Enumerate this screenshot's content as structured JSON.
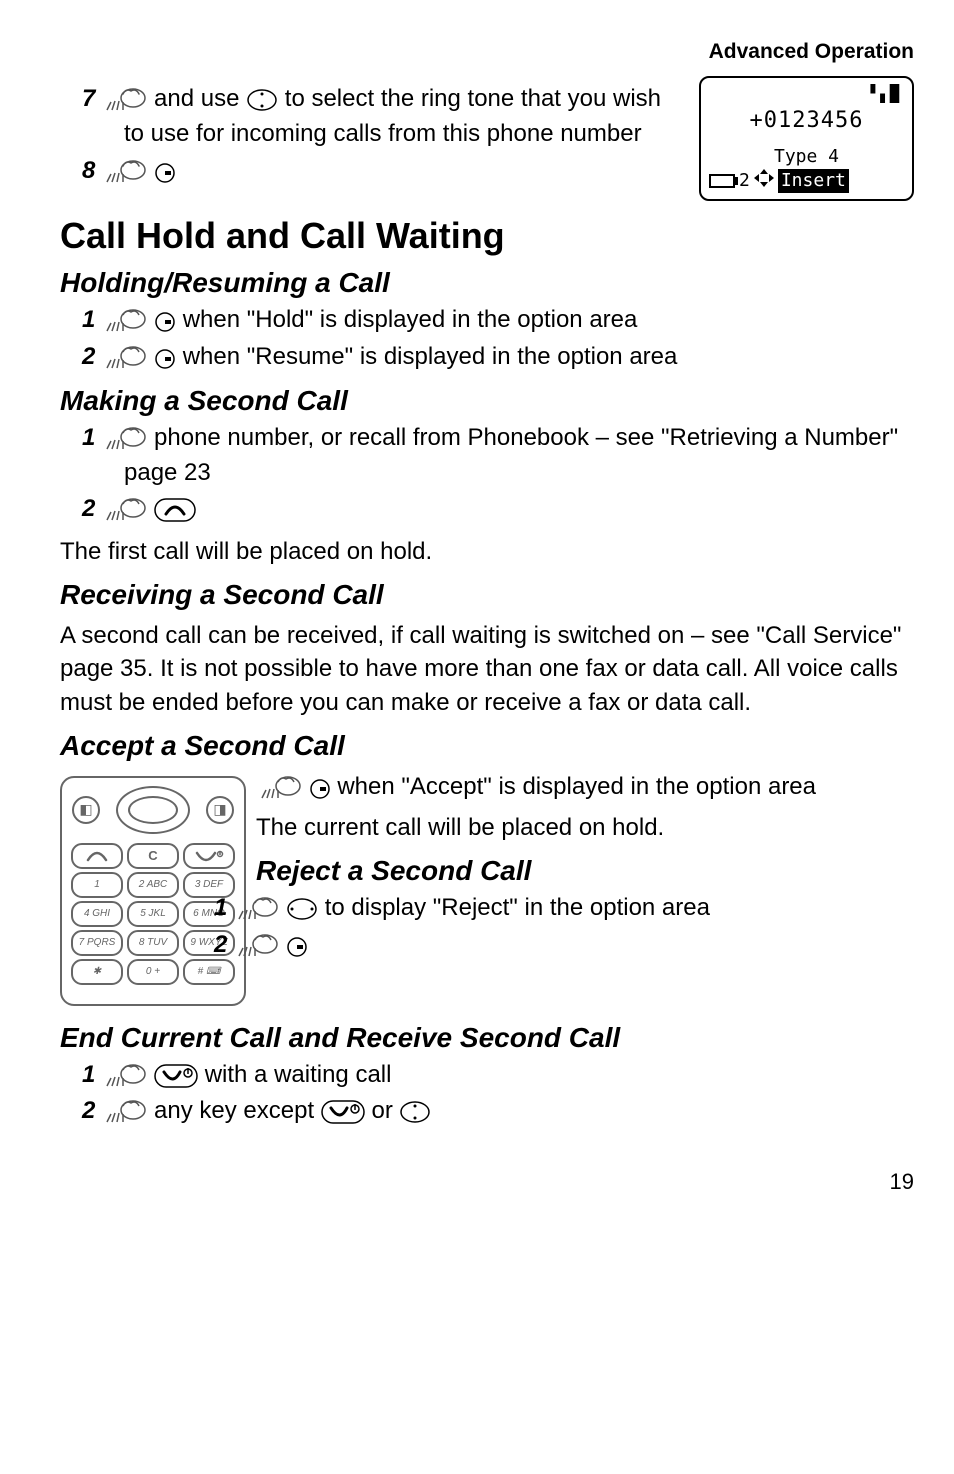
{
  "header": {
    "section_title": "Advanced Operation"
  },
  "phone_screen": {
    "signal": "▝▖▗▐",
    "number": "+0123456",
    "type_label": "Type 4",
    "bottom_num": "2",
    "insert_label": "Insert"
  },
  "pre_steps": {
    "step7": {
      "num": "7",
      "text_a": " and use ",
      "text_b": " to select the ring tone that you wish to use for incoming calls from this phone number"
    },
    "step8": {
      "num": "8"
    }
  },
  "h1": "Call Hold and Call Waiting",
  "sections": {
    "holding": {
      "title": "Holding/Resuming a Call",
      "step1": {
        "num": "1",
        "text": " when \"Hold\" is displayed in the option area"
      },
      "step2": {
        "num": "2",
        "text": " when \"Resume\" is displayed in the option area"
      }
    },
    "making": {
      "title": "Making a Second Call",
      "step1": {
        "num": "1",
        "text": " phone number, or recall from Phonebook – see \"Retrieving a Number\" page 23"
      },
      "step2": {
        "num": "2"
      },
      "after": "The first call will be placed on hold."
    },
    "receiving": {
      "title": "Receiving a Second Call",
      "para": "A second call can be received, if call waiting is switched on – see \"Call Service\" page 35. It is not possible to have more than one fax or data call. All voice calls must be ended before you can make or receive a fax or data call."
    },
    "accept": {
      "title": "Accept a Second Call",
      "line1": " when \"Accept\" is displayed in the option area",
      "after": "The current call will be placed on hold."
    },
    "reject": {
      "title": "Reject a Second Call",
      "step1": {
        "num": "1",
        "text": " to display \"Reject\" in the option area"
      },
      "step2": {
        "num": "2"
      }
    },
    "end_current": {
      "title": "End Current Call and Receive Second Call",
      "step1": {
        "num": "1",
        "text": " with a waiting call"
      },
      "step2": {
        "num": "2",
        "text_a": " any key except ",
        "text_b": " or "
      }
    }
  },
  "keypad": {
    "row2": [
      "1",
      "2 ABC",
      "3 DEF"
    ],
    "row3": [
      "4 GHI",
      "5 JKL",
      "6 MNO"
    ],
    "row4": [
      "7 PQRS",
      "8 TUV",
      "9 WXYZ"
    ],
    "row5": [
      "✱",
      "0 +",
      "# ⌨"
    ]
  },
  "page_number": "19"
}
